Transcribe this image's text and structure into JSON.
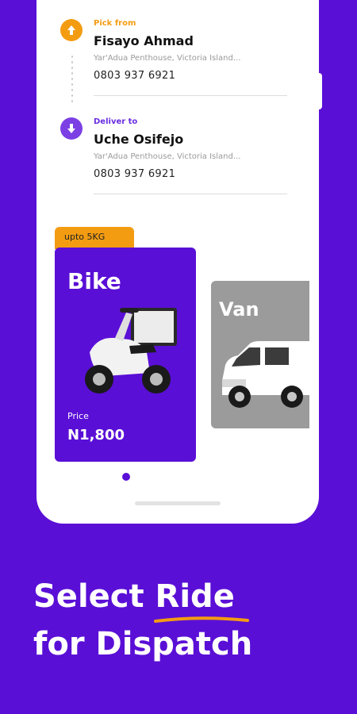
{
  "pickup": {
    "label": "Pick from",
    "name": "Fisayo Ahmad",
    "address": "Yar'Adua Penthouse, Victoria Island...",
    "phone": "0803 937 6921"
  },
  "delivery": {
    "label": "Deliver to",
    "name": "Uche Osifejo",
    "address": "Yar'Adua Penthouse, Victoria Island...",
    "phone": "0803 937 6921"
  },
  "rides": [
    {
      "badge": "upto 5KG",
      "title": "Bike",
      "price_label": "Price",
      "price": "N1,800"
    },
    {
      "title": "Van"
    }
  ],
  "headline": {
    "line1_a": "Select ",
    "line1_highlight": "Ride",
    "line2": "for Dispatch"
  },
  "colors": {
    "brand": "#5a0fd6",
    "accent": "#f39c12",
    "pickup_icon": "#f39c12",
    "deliver_icon": "#7b3fe4",
    "card_inactive": "#9b9b9b"
  },
  "icons": {
    "pickup": "arrow-up-circle-icon",
    "delivery": "arrow-down-circle-icon"
  }
}
